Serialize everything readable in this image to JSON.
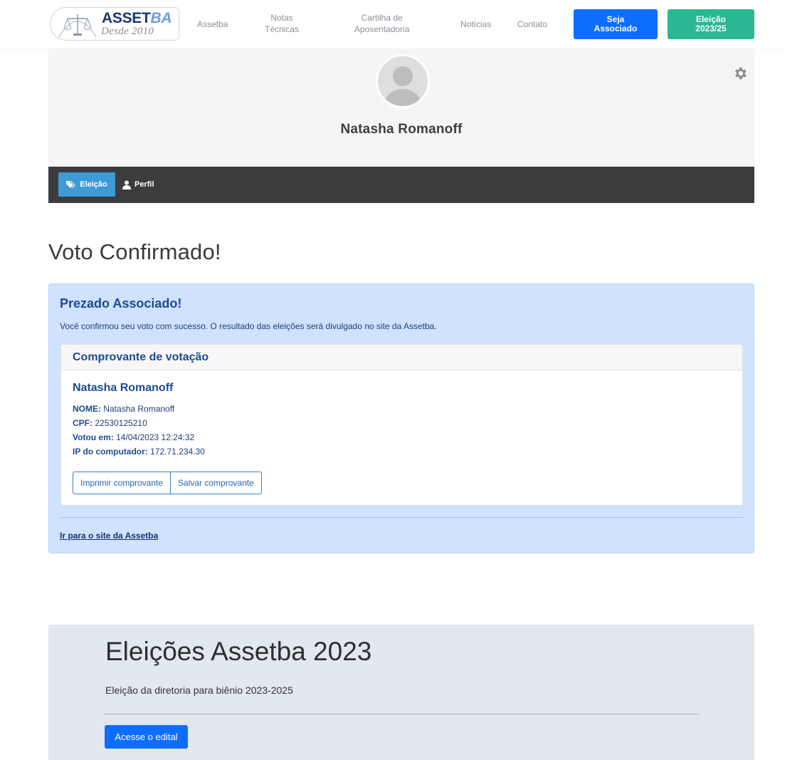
{
  "brand": {
    "name_main": "ASSET",
    "name_accent": "BA",
    "tagline": "Desde 2010"
  },
  "nav": {
    "links": [
      "Assetba",
      "Notas\nTécnicas",
      "Cartilha de\nAposentadoria",
      "Notícias",
      "Contato"
    ],
    "buttons": [
      {
        "label": "Seja\nAssociado",
        "color": "#0d6efd"
      },
      {
        "label": "Eleição\n2023/25",
        "color": "#29b794"
      }
    ]
  },
  "profile": {
    "name": "Natasha Romanoff",
    "settings_icon": "gear-icon"
  },
  "tabs": [
    {
      "label": "Eleição",
      "icon": "tags-icon",
      "active": true
    },
    {
      "label": "Perfil",
      "icon": "user-icon",
      "active": false
    }
  ],
  "page": {
    "heading": "Voto Confirmado!"
  },
  "alert": {
    "title": "Prezado Associado!",
    "message": "Você confirmou seu voto com sucesso. O resultado das eleições será divulgado no site da Assetba.",
    "link_label": "Ir para o site da Assetba"
  },
  "receipt": {
    "header": "Comprovante de votação",
    "name": "Natasha Romanoff",
    "fields": [
      {
        "label": "NOME:",
        "value": "Natasha Romanoff"
      },
      {
        "label": "CPF:",
        "value": "22530125210"
      },
      {
        "label": "Votou em:",
        "value": "14/04/2023 12:24:32"
      },
      {
        "label": "IP do computador:",
        "value": "172.71.234.30"
      }
    ],
    "buttons": {
      "print": "Imprimir comprovante",
      "save": "Salvar comprovante"
    }
  },
  "jumbotron": {
    "title": "Eleições Assetba 2023",
    "subtitle": "Eleição da diretoria para biênio 2023-2025",
    "button": "Acesse o edital"
  },
  "colors": {
    "primary": "#0d6efd",
    "success": "#29b794",
    "tab_active": "#3e9bd6",
    "alert_bg": "#cfe2ff",
    "dark_bar": "#3c3c3c"
  }
}
